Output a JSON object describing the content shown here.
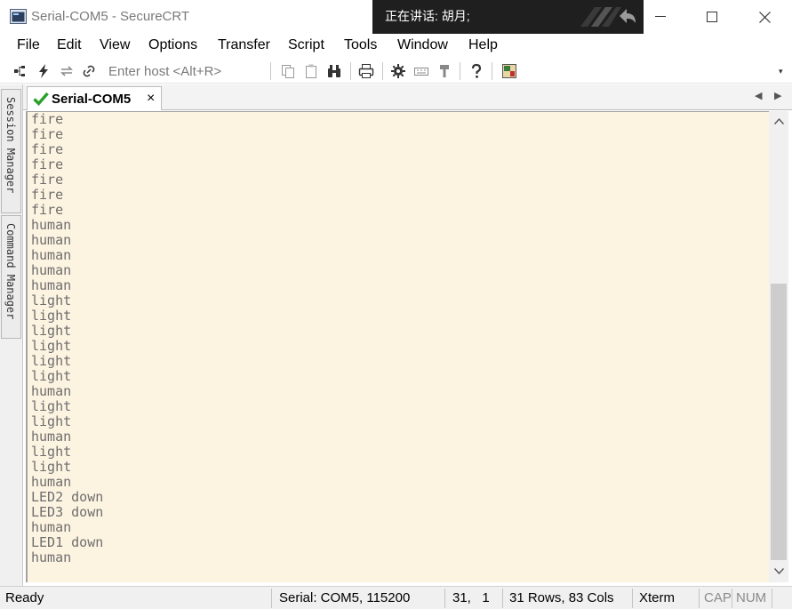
{
  "window": {
    "title": "Serial-COM5 - SecureCRT",
    "speaking_overlay": "正在讲话: 胡月;"
  },
  "menu": [
    "File",
    "Edit",
    "View",
    "Options",
    "Transfer",
    "Script",
    "Tools",
    "Window",
    "Help"
  ],
  "toolbar": {
    "host_placeholder": "Enter host <Alt+R>"
  },
  "side_tabs": [
    "Session Manager",
    "Command Manager"
  ],
  "tab": {
    "label": "Serial-COM5",
    "close": "×"
  },
  "terminal": {
    "lines": [
      "fire",
      "fire",
      "fire",
      "fire",
      "fire",
      "fire",
      "fire",
      "human",
      "human",
      "human",
      "human",
      "human",
      "light",
      "light",
      "light",
      "light",
      "light",
      "light",
      "human",
      "light",
      "light",
      "human",
      "light",
      "light",
      "human",
      "LED2 down",
      "LED3 down",
      "human",
      "LED1 down",
      "human"
    ]
  },
  "status": {
    "ready": "Ready",
    "connection": "Serial: COM5, 115200",
    "cursor": "31,   1",
    "size": "31 Rows, 83 Cols",
    "terminal_type": "Xterm",
    "cap": "CAP",
    "num": "NUM"
  }
}
